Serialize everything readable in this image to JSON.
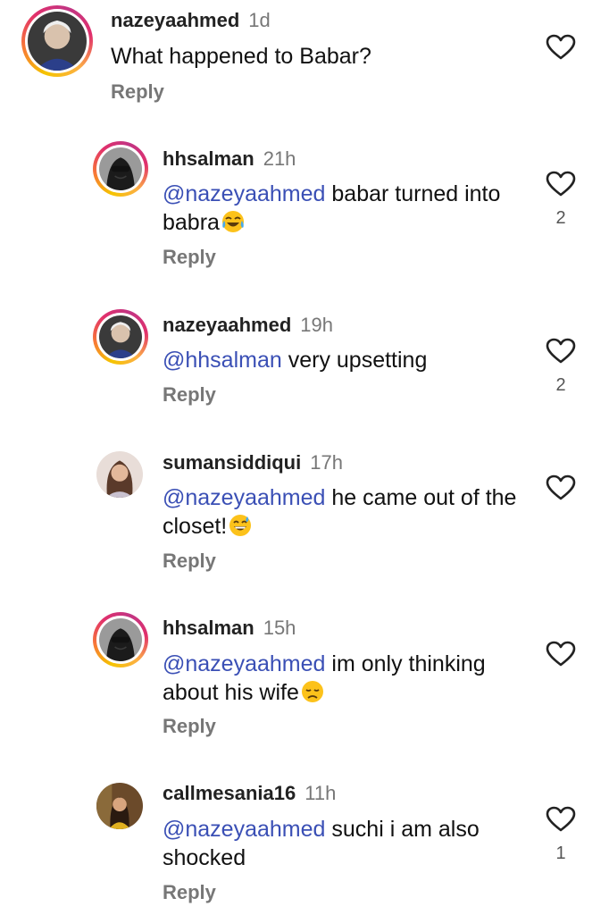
{
  "comments": [
    {
      "username": "nazeyaahmed",
      "time": "1d",
      "mention": "",
      "text": "What happened to Babar?",
      "emoji": "",
      "reply": "Reply",
      "likes": ""
    },
    {
      "username": "hhsalman",
      "time": "21h",
      "mention": "@nazeyaahmed",
      "text": " babar turned into babra",
      "emoji": "face-with-tears-of-joy",
      "reply": "Reply",
      "likes": "2"
    },
    {
      "username": "nazeyaahmed",
      "time": "19h",
      "mention": "@hhsalman",
      "text": " very upsetting",
      "emoji": "",
      "reply": "Reply",
      "likes": "2"
    },
    {
      "username": "sumansiddiqui",
      "time": "17h",
      "mention": "@nazeyaahmed",
      "text": " he came out of the closet!",
      "emoji": "grinning-face-with-sweat",
      "reply": "Reply",
      "likes": ""
    },
    {
      "username": "hhsalman",
      "time": "15h",
      "mention": "@nazeyaahmed",
      "text": " im only thinking about his wife",
      "emoji": "disappointed-face",
      "reply": "Reply",
      "likes": ""
    },
    {
      "username": "callmesania16",
      "time": "11h",
      "mention": "@nazeyaahmed",
      "text": " suchi i am also shocked",
      "emoji": "",
      "reply": "Reply",
      "likes": "1"
    }
  ],
  "icons": {
    "like": "heart-outline-icon"
  },
  "colors": {
    "mention": "#3a4fb5",
    "secondary_text": "#777777",
    "story_ring_start": "#f5c400",
    "story_ring_end": "#e1306c"
  }
}
